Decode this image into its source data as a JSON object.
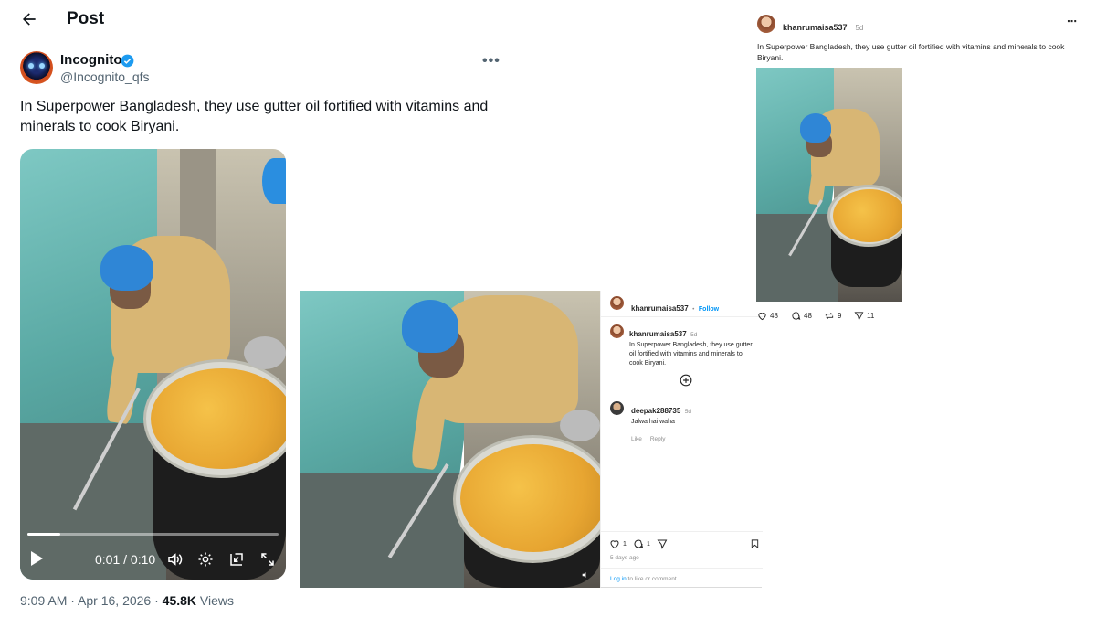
{
  "x_post": {
    "header_title": "Post",
    "display_name": "Incognito",
    "handle": "@Incognito_qfs",
    "text": "In Superpower Bangladesh, they use gutter oil fortified with vitamins and minerals to cook Biryani.",
    "video": {
      "current_time": "0:01",
      "separator": "/",
      "duration": "0:10",
      "progress": 0.13
    },
    "time": "9:09 AM",
    "date": "Apr 16, 2026",
    "views_count": "45.8K",
    "views_label": "Views",
    "colors": {
      "verified": "#1d9bf0",
      "text": "#0f1419",
      "muted": "#536471"
    }
  },
  "ig_mid": {
    "username": "khanrumaisa537",
    "follow_label": "Follow",
    "caption_user": "khanrumaisa537",
    "caption_age": "5d",
    "caption": "In Superpower Bangladesh, they use gutter oil fortified with vitamins and minerals to cook Biryani.",
    "comment_user": "deepak288735",
    "comment_age": "5d",
    "comment_text": "Jalwa hai waha",
    "like_label": "Like",
    "reply_label": "Reply",
    "likes": "1",
    "comments": "1",
    "posted": "5 days ago",
    "login_link": "Log in",
    "login_rest": "to like or comment."
  },
  "ig_right": {
    "username": "khanrumaisa537",
    "age": "5d",
    "caption": "In Superpower Bangladesh, they use gutter oil fortified with vitamins and minerals to cook Biryani.",
    "likes": "48",
    "comments": "48",
    "reposts": "9",
    "shares": "11"
  }
}
